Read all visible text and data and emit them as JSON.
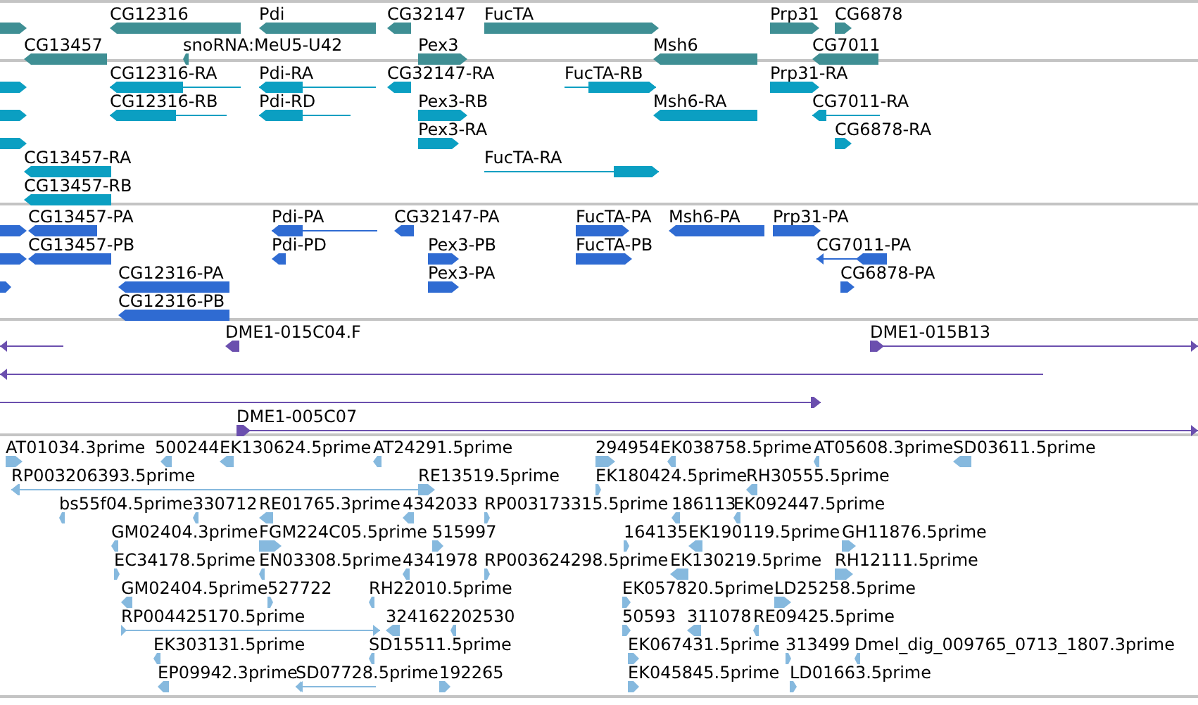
{
  "tracks": [
    {
      "color": "#3f8f94",
      "features": [
        {
          "reverse": false
        },
        {
          "label": "CG12316",
          "reverse": true
        },
        {
          "label": "Pdi",
          "reverse": true
        },
        {
          "label": "CG32147",
          "reverse": true
        },
        {
          "label": "FucTA",
          "reverse": false
        },
        {
          "label": "Prp31",
          "reverse": false
        },
        {
          "label": "CG6878",
          "reverse": false
        },
        {
          "label": "CG13457",
          "reverse": true
        },
        {
          "label": "snoRNA:MeU5-U42",
          "reverse": true
        },
        {
          "label": "Pex3",
          "reverse": false
        },
        {
          "label": "Msh6",
          "reverse": true
        },
        {
          "label": "CG7011",
          "reverse": true
        }
      ]
    },
    {
      "color": "#0b9fc2",
      "features": [
        {
          "reverse": false
        },
        {
          "label": "CG12316-RA",
          "reverse": true
        },
        {
          "label": "Pdi-RA",
          "reverse": true
        },
        {
          "label": "CG32147-RA",
          "reverse": true
        },
        {
          "label": "FucTA-RB",
          "reverse": false
        },
        {
          "label": "Prp31-RA",
          "reverse": false
        },
        {
          "reverse": false
        },
        {
          "label": "CG12316-RB",
          "reverse": true
        },
        {
          "label": "Pdi-RD",
          "reverse": true
        },
        {
          "label": "Pex3-RB",
          "reverse": false
        },
        {
          "label": "Msh6-RA",
          "reverse": true
        },
        {
          "label": "CG7011-RA",
          "reverse": true
        },
        {
          "reverse": false
        },
        {
          "label": "Pex3-RA",
          "reverse": false
        },
        {
          "label": "CG6878-RA",
          "reverse": false
        },
        {
          "label": "CG13457-RA",
          "reverse": true
        },
        {
          "label": "FucTA-RA",
          "reverse": false
        },
        {
          "label": "CG13457-RB",
          "reverse": true
        }
      ]
    },
    {
      "color": "#2f6bd2",
      "features": [
        {
          "reverse": false
        },
        {
          "label": "CG13457-PA",
          "reverse": true
        },
        {
          "label": "Pdi-PA",
          "reverse": true
        },
        {
          "label": "CG32147-PA",
          "reverse": true
        },
        {
          "label": "FucTA-PA",
          "reverse": false
        },
        {
          "label": "Msh6-PA",
          "reverse": true
        },
        {
          "label": "Prp31-PA",
          "reverse": false
        },
        {
          "reverse": false
        },
        {
          "label": "CG13457-PB",
          "reverse": true
        },
        {
          "label": "Pdi-PD",
          "reverse": true
        },
        {
          "label": "Pex3-PB",
          "reverse": false
        },
        {
          "label": "FucTA-PB",
          "reverse": false
        },
        {
          "label": "CG7011-PA",
          "reverse": true
        },
        {
          "reverse": false
        },
        {
          "label": "CG12316-PA",
          "reverse": true
        },
        {
          "label": "Pex3-PA",
          "reverse": false
        },
        {
          "label": "CG6878-PA",
          "reverse": false
        },
        {
          "label": "CG12316-PB",
          "reverse": true
        }
      ]
    },
    {
      "color": "#6b4fae",
      "features": [
        {
          "reverse": true
        },
        {
          "label": "DME1-015C04.F",
          "reverse": true
        },
        {
          "label": "DME1-015B13",
          "reverse": false
        },
        {
          "reverse": true
        },
        {
          "reverse": false
        },
        {
          "label": "DME1-005C07",
          "reverse": false
        }
      ]
    },
    {
      "color": "#86b9de",
      "features": [
        {
          "label": "AT01034.3prime",
          "reverse": false
        },
        {
          "label": "500244",
          "reverse": true
        },
        {
          "label": "EK130624.5prime",
          "reverse": true
        },
        {
          "label": "AT24291.5prime",
          "reverse": true
        },
        {
          "label": "294954",
          "reverse": false
        },
        {
          "label": "EK038758.5prime",
          "reverse": true
        },
        {
          "label": "AT05608.3prime",
          "reverse": true
        },
        {
          "label": "SD03611.5prime",
          "reverse": true
        },
        {
          "label": "RP003206393.5prime",
          "reverse": true
        },
        {
          "label": "RE13519.5prime",
          "reverse": false
        },
        {
          "label": "EK180424.5prime",
          "reverse": false
        },
        {
          "label": "RH30555.5prime",
          "reverse": true
        },
        {
          "label": "bs55f04.5prime",
          "reverse": true
        },
        {
          "label": "330712",
          "reverse": true
        },
        {
          "label": "RE01765.3prime",
          "reverse": true
        },
        {
          "label": "4342033",
          "reverse": true
        },
        {
          "label": "RP003173315.5prime",
          "reverse": false
        },
        {
          "label": "186113",
          "reverse": true
        },
        {
          "label": "EK092447.5prime",
          "reverse": true
        },
        {
          "label": "GM02404.3prime",
          "reverse": true
        },
        {
          "label": "FGM224C05.5prime",
          "reverse": false
        },
        {
          "label": "515997",
          "reverse": false
        },
        {
          "label": "164135",
          "reverse": false
        },
        {
          "label": "EK190119.5prime",
          "reverse": true
        },
        {
          "label": "GH11876.5prime",
          "reverse": false
        },
        {
          "label": "EC34178.5prime",
          "reverse": false
        },
        {
          "label": "EN03308.5prime",
          "reverse": true
        },
        {
          "label": "4341978",
          "reverse": true
        },
        {
          "label": "RP003624298.5prime",
          "reverse": false
        },
        {
          "label": "EK130219.5prime",
          "reverse": true
        },
        {
          "label": "RH12111.5prime",
          "reverse": false
        },
        {
          "label": "GM02404.5prime",
          "reverse": true
        },
        {
          "label": "527722",
          "reverse": false
        },
        {
          "label": "RH22010.5prime",
          "reverse": true
        },
        {
          "label": "EK057820.5prime",
          "reverse": false
        },
        {
          "label": "LD25258.5prime",
          "reverse": false
        },
        {
          "label": "RP004425170.5prime",
          "reverse": false
        },
        {
          "label": "324162",
          "reverse": true
        },
        {
          "label": "202530",
          "reverse": true
        },
        {
          "label": "50593",
          "reverse": false
        },
        {
          "label": "311078",
          "reverse": true
        },
        {
          "label": "RE09425.5prime",
          "reverse": true
        },
        {
          "label": "EK303131.5prime",
          "reverse": true
        },
        {
          "label": "SD15511.5prime",
          "reverse": true
        },
        {
          "label": "EK067431.5prime",
          "reverse": false
        },
        {
          "label": "313499",
          "reverse": false
        },
        {
          "label": "Dmel_dig_009765_0713_1807.3prime",
          "reverse": true
        },
        {
          "label": "EP09942.3prime",
          "reverse": true
        },
        {
          "label": "SD07728.5prime",
          "reverse": true
        },
        {
          "label": "192265",
          "reverse": false
        },
        {
          "label": "EK045845.5prime",
          "reverse": false
        },
        {
          "label": "LD01663.5prime",
          "reverse": false
        }
      ]
    }
  ]
}
